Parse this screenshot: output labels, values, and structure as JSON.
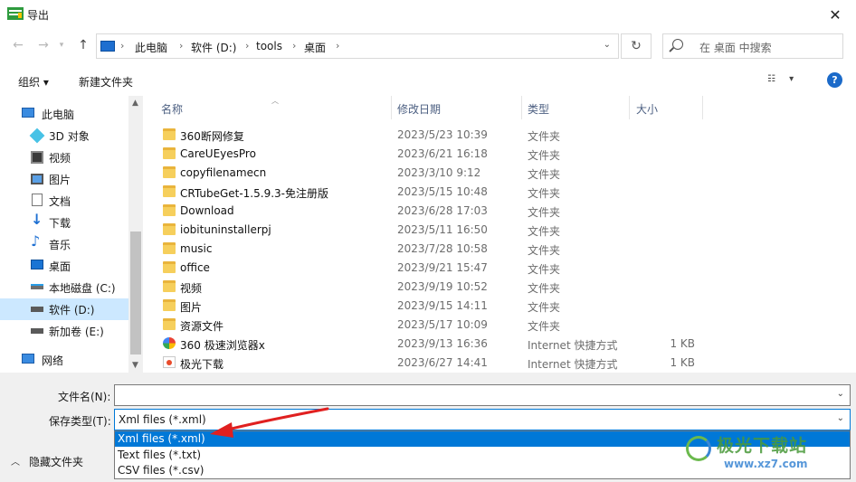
{
  "window": {
    "title": "导出"
  },
  "nav": {
    "breadcrumbs": [
      "此电脑",
      "软件 (D:)",
      "tools",
      "桌面"
    ],
    "search_placeholder": "在 桌面 中搜索"
  },
  "toolbar": {
    "organize_label": "组织 ▾",
    "new_folder_label": "新建文件夹"
  },
  "sidebar": {
    "items": [
      {
        "label": "此电脑",
        "icon": "computer-icon"
      },
      {
        "label": "3D 对象",
        "icon": "cube-icon"
      },
      {
        "label": "视频",
        "icon": "video-icon"
      },
      {
        "label": "图片",
        "icon": "picture-icon"
      },
      {
        "label": "文档",
        "icon": "document-icon"
      },
      {
        "label": "下载",
        "icon": "download-icon"
      },
      {
        "label": "音乐",
        "icon": "music-icon"
      },
      {
        "label": "桌面",
        "icon": "desktop-icon"
      },
      {
        "label": "本地磁盘 (C:)",
        "icon": "drive-icon"
      },
      {
        "label": "软件 (D:)",
        "icon": "drive-icon",
        "selected": true
      },
      {
        "label": "新加卷 (E:)",
        "icon": "drive-icon"
      },
      {
        "label": "网络",
        "icon": "network-icon"
      }
    ]
  },
  "columns": {
    "name": "名称",
    "date": "修改日期",
    "type": "类型",
    "size": "大小"
  },
  "files": [
    {
      "name": "360断网修复",
      "date": "2023/5/23 10:39",
      "type": "文件夹",
      "size": "",
      "icon": "folder"
    },
    {
      "name": "CareUEyesPro",
      "date": "2023/6/21 16:18",
      "type": "文件夹",
      "size": "",
      "icon": "folder"
    },
    {
      "name": "copyfilenamecn",
      "date": "2023/3/10 9:12",
      "type": "文件夹",
      "size": "",
      "icon": "folder"
    },
    {
      "name": "CRTubeGet-1.5.9.3-免注册版",
      "date": "2023/5/15 10:48",
      "type": "文件夹",
      "size": "",
      "icon": "folder"
    },
    {
      "name": "Download",
      "date": "2023/6/28 17:03",
      "type": "文件夹",
      "size": "",
      "icon": "folder"
    },
    {
      "name": "iobituninstallerpj",
      "date": "2023/5/11 16:50",
      "type": "文件夹",
      "size": "",
      "icon": "folder"
    },
    {
      "name": "music",
      "date": "2023/7/28 10:58",
      "type": "文件夹",
      "size": "",
      "icon": "folder"
    },
    {
      "name": "office",
      "date": "2023/9/21 15:47",
      "type": "文件夹",
      "size": "",
      "icon": "folder"
    },
    {
      "name": "视频",
      "date": "2023/9/19 10:52",
      "type": "文件夹",
      "size": "",
      "icon": "folder"
    },
    {
      "name": "图片",
      "date": "2023/9/15 14:11",
      "type": "文件夹",
      "size": "",
      "icon": "folder"
    },
    {
      "name": "资源文件",
      "date": "2023/5/17 10:09",
      "type": "文件夹",
      "size": "",
      "icon": "folder"
    },
    {
      "name": "360 极速浏览器x",
      "date": "2023/9/13 16:36",
      "type": "Internet 快捷方式",
      "size": "1 KB",
      "icon": "browser"
    },
    {
      "name": "极光下载",
      "date": "2023/6/27 14:41",
      "type": "Internet 快捷方式",
      "size": "1 KB",
      "icon": "shortcut"
    }
  ],
  "bottom": {
    "filename_label": "文件名(N):",
    "filename_value": "",
    "filetype_label": "保存类型(T):",
    "filetype_value": "Xml files (*.xml)",
    "filetype_options": [
      "Xml files (*.xml)",
      "Text files (*.txt)",
      "CSV files (*.csv)"
    ],
    "hide_folders_label": "隐藏文件夹"
  },
  "watermark": {
    "text": "极光下载站",
    "url": "www.xz7.com"
  },
  "colors": {
    "accent": "#0078d7",
    "selected_row": "#cce8ff",
    "arrow": "#e02020",
    "folder": "#f6cf5c"
  }
}
